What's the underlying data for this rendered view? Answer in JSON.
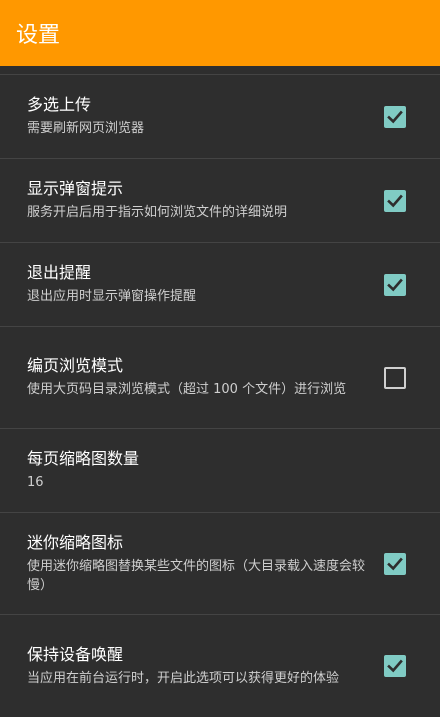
{
  "appbar": {
    "title": "设置"
  },
  "settings": [
    {
      "title": "多选上传",
      "summary": "需要刷新网页浏览器",
      "checked": true
    },
    {
      "title": "显示弹窗提示",
      "summary": "服务开启后用于指示如何浏览文件的详细说明",
      "checked": true
    },
    {
      "title": "退出提醒",
      "summary": "退出应用时显示弹窗操作提醒",
      "checked": true
    },
    {
      "title": "编页浏览模式",
      "summary": "使用大页码目录浏览模式（超过 100 个文件）进行浏览",
      "checked": false
    },
    {
      "title": "每页缩略图数量",
      "summary": "16"
    },
    {
      "title": "迷你缩略图标",
      "summary": "使用迷你缩略图替换某些文件的图标（大目录载入速度会较慢）",
      "checked": true
    },
    {
      "title": "保持设备唤醒",
      "summary": "当应用在前台运行时，开启此选项可以获得更好的体验",
      "checked": true
    }
  ],
  "colors": {
    "accent": "#ff9800",
    "checkbox": "#80cbc4",
    "background": "#2e2e2e"
  },
  "icons": {
    "checked": "checkbox-checked-icon",
    "unchecked": "checkbox-unchecked-icon"
  }
}
